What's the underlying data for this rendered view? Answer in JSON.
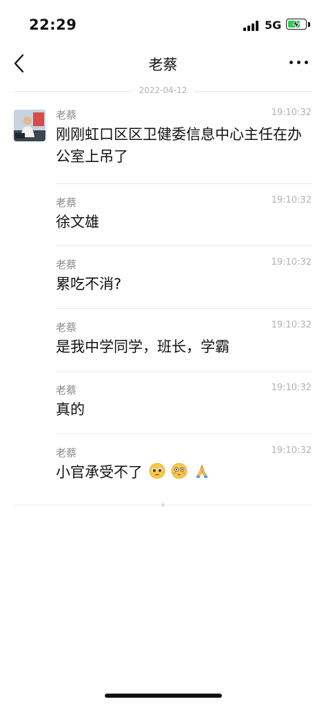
{
  "status_bar": {
    "time": "22:29",
    "network": "5G",
    "battery_level": 0.75,
    "charging": true
  },
  "header": {
    "title": "老蔡"
  },
  "date_separator": "2022-04-12",
  "messages": [
    {
      "sender": "老蔡",
      "time": "19:10:32",
      "text": "刚刚虹口区区卫健委信息中心主任在办公室上吊了"
    },
    {
      "sender": "老蔡",
      "time": "19:10:32",
      "text": "徐文雄"
    },
    {
      "sender": "老蔡",
      "time": "19:10:32",
      "text": "累吃不消?"
    },
    {
      "sender": "老蔡",
      "time": "19:10:32",
      "text": "是我中学同学，班长，学霸"
    },
    {
      "sender": "老蔡",
      "time": "19:10:32",
      "text": "真的"
    },
    {
      "sender": "老蔡",
      "time": "19:10:32",
      "text": "小官承受不了",
      "emojis": [
        "pleading-face-icon",
        "flushed-face-icon",
        "folded-hands-icon"
      ]
    }
  ],
  "colors": {
    "battery": "#34c759",
    "meta_text": "#8a8a8a",
    "time_text": "#b2b2b2"
  }
}
